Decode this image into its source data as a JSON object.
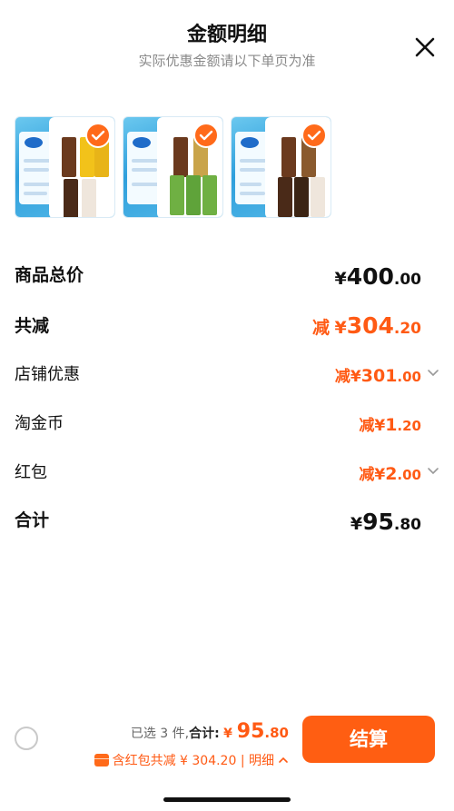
{
  "header": {
    "title": "金额明细",
    "subtitle": "实际优惠金额请以下单页为准",
    "close_icon": "close-icon"
  },
  "items": [
    {
      "name": "product-thumb-1",
      "selected": true
    },
    {
      "name": "product-thumb-2",
      "selected": true
    },
    {
      "name": "product-thumb-3",
      "selected": true
    }
  ],
  "rows": {
    "total_price": {
      "label": "商品总价",
      "yen": "¥",
      "int": "400",
      "dec": ".00"
    },
    "total_discount": {
      "label": "共减",
      "prefix": "减",
      "yen": "¥",
      "int": "304",
      "dec": ".20"
    },
    "shop_discount": {
      "label": "店铺优惠",
      "prefix": "减",
      "yen": "¥",
      "int": "301",
      "dec": ".00"
    },
    "taojinbi": {
      "label": "淘金币",
      "prefix": "减",
      "yen": "¥",
      "int": "1",
      "dec": ".20"
    },
    "red_packet": {
      "label": "红包",
      "prefix": "减",
      "yen": "¥",
      "int": "2",
      "dec": ".00"
    },
    "grand_total": {
      "label": "合计",
      "yen": "¥",
      "int": "95",
      "dec": ".80"
    }
  },
  "bottom_bar": {
    "selected_text": "已选 3 件,",
    "total_label": "合计:",
    "yen": "¥ ",
    "int": "95",
    "dec": ".80",
    "detail_text": "含红包共减 ¥ 304.20 | 明细",
    "checkout_label": "结算"
  },
  "colors": {
    "accent": "#ff5a14",
    "button": "#ff5e12"
  }
}
